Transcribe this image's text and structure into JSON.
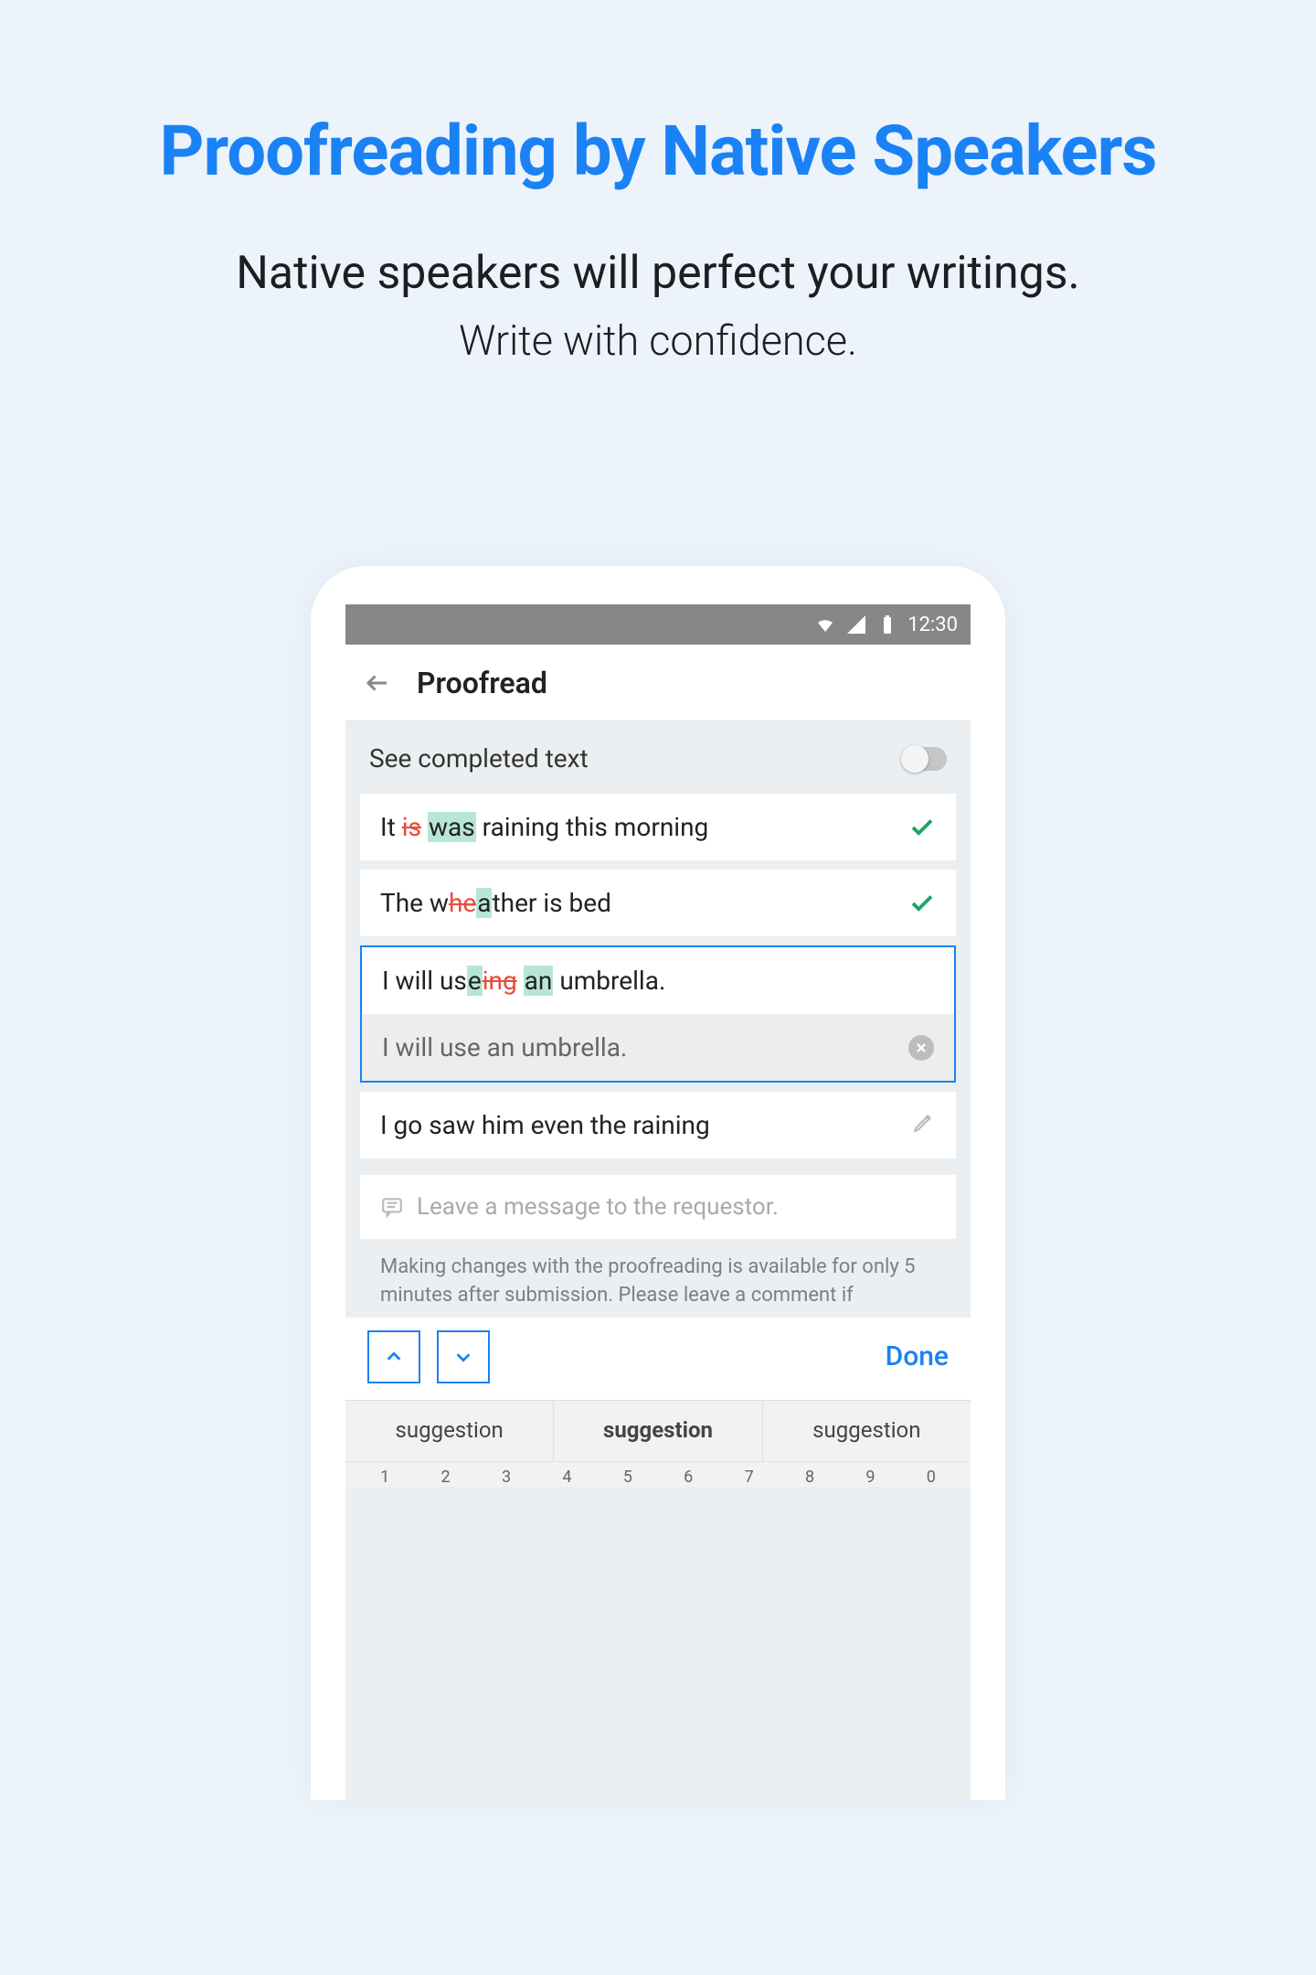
{
  "hero": {
    "title": "Proofreading by Native Speakers",
    "sub1": "Native speakers will perfect your writings.",
    "sub2": "Write with confidence."
  },
  "phone": {
    "statusTime": "12:30",
    "appTitle": "Proofread",
    "toggleLabel": "See completed text",
    "rows": {
      "r1_pre": "It ",
      "r1_strike": "is",
      "r1_space": " ",
      "r1_hl": "was",
      "r1_post": " raining this morning",
      "r2_pre": "The w",
      "r2_strike": "he",
      "r2_hl": "a",
      "r2_post": "ther is bed",
      "r3_pre": "I will us",
      "r3_hl1": "e",
      "r3_strike": "ing",
      "r3_sp": " ",
      "r3_hl2": "an",
      "r3_post": " umbrella.",
      "suggestion": "I will use an umbrella.",
      "r4": "I go saw him even the raining"
    },
    "msgPlaceholder": "Leave a message to the requestor.",
    "disclaimer": "Making changes with the proofreading is available for only 5 minutes after submission. Please leave a comment if",
    "done": "Done",
    "suggestions": {
      "a": "suggestion",
      "b": "suggestion",
      "c": "suggestion"
    },
    "nums": [
      "1",
      "2",
      "3",
      "4",
      "5",
      "6",
      "7",
      "8",
      "9",
      "0"
    ]
  }
}
